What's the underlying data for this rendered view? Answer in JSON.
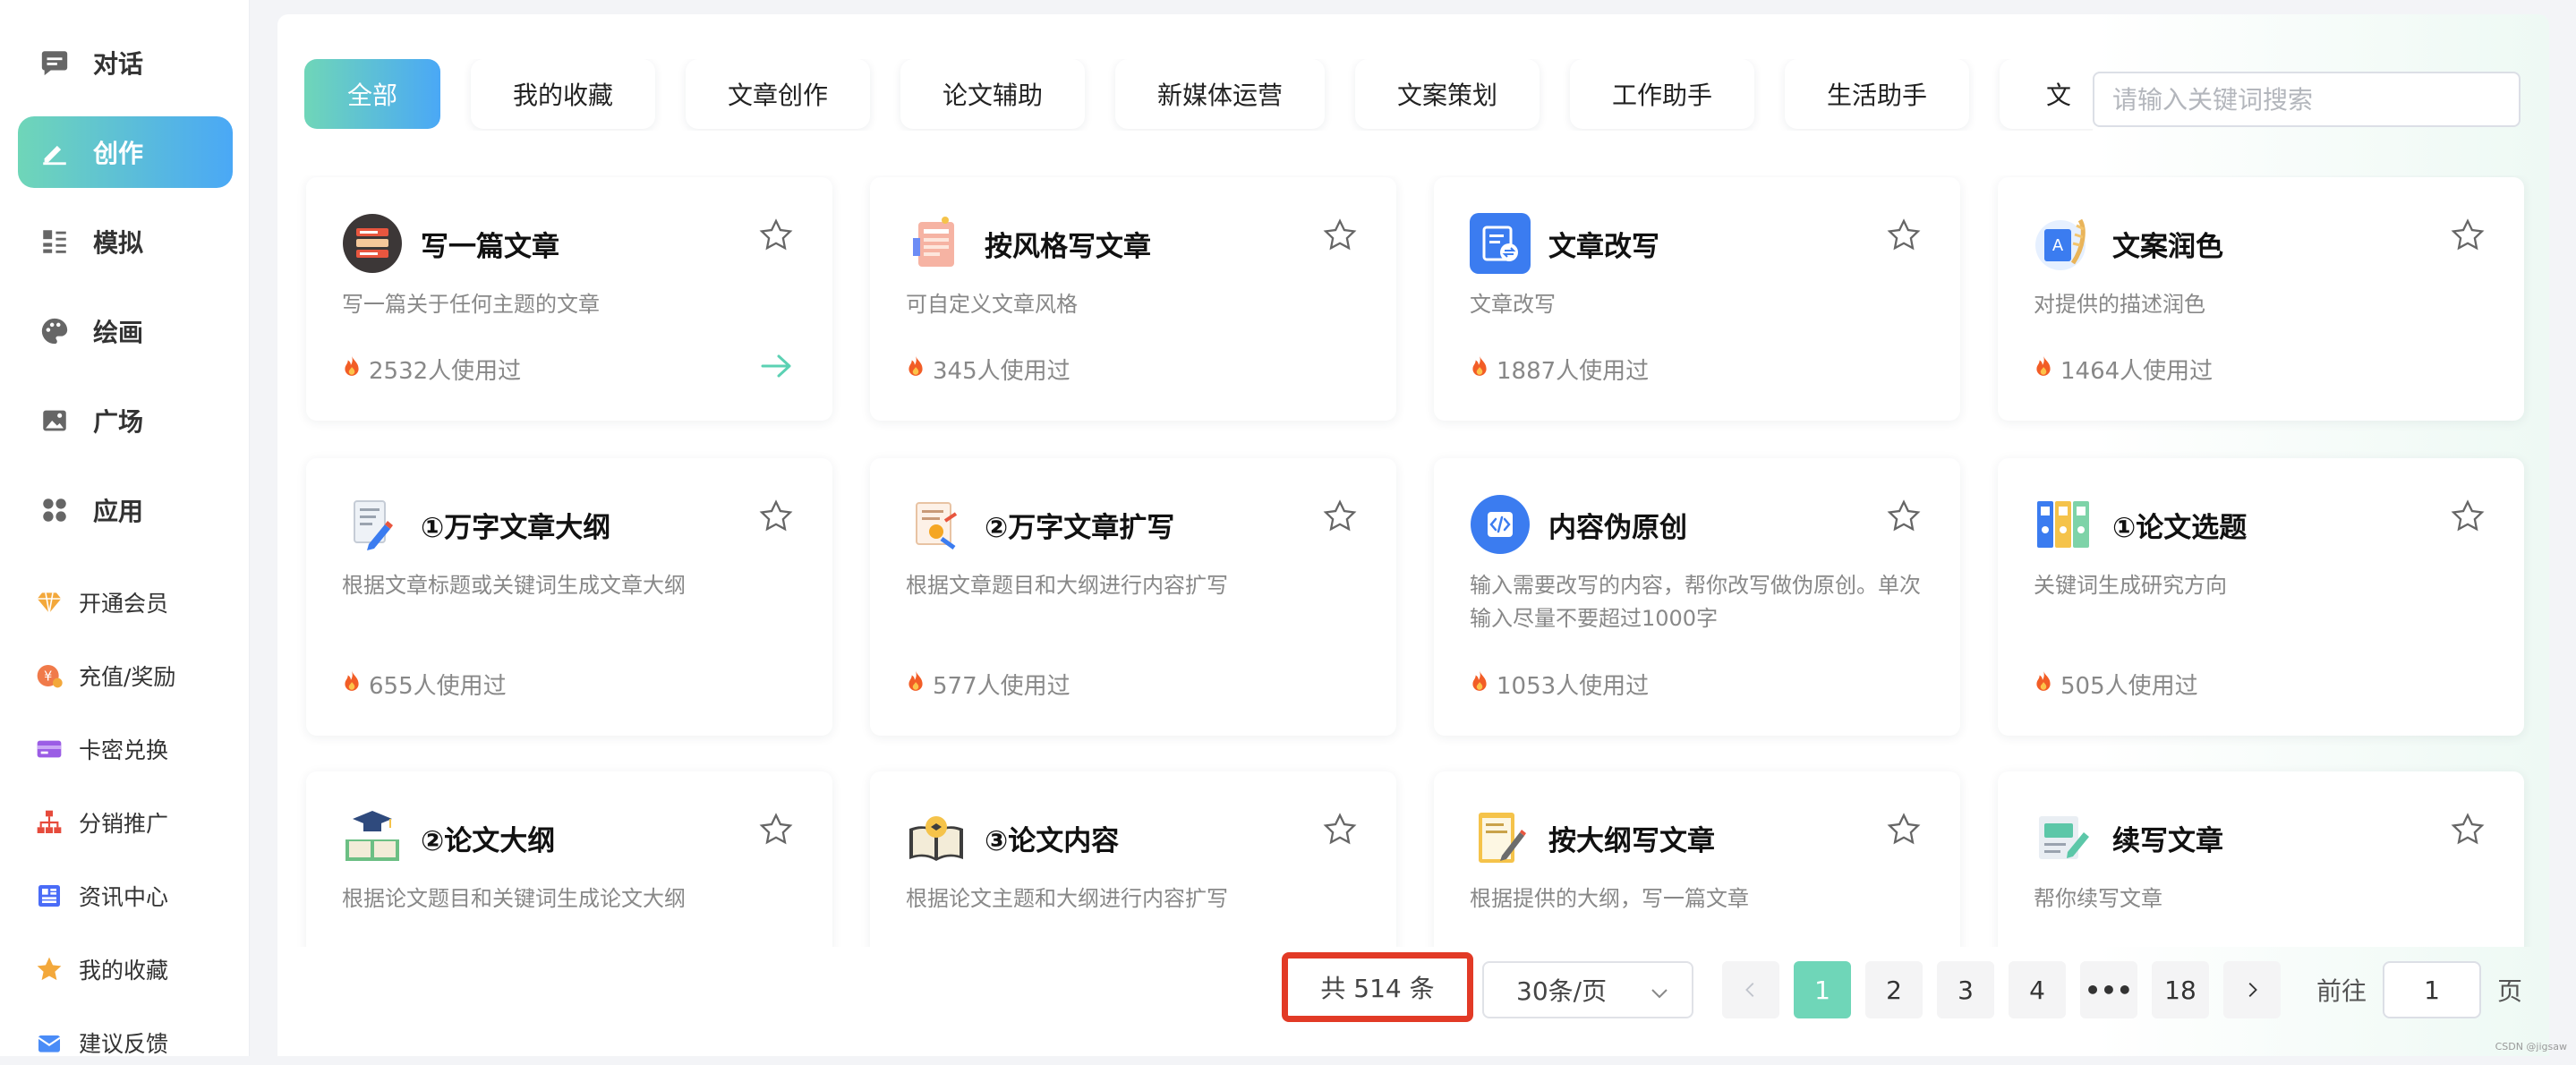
{
  "sidebar": {
    "nav": [
      {
        "label": "对话",
        "icon": "chat-icon"
      },
      {
        "label": "创作",
        "icon": "edit-icon",
        "active": true
      },
      {
        "label": "模拟",
        "icon": "list-icon"
      },
      {
        "label": "绘画",
        "icon": "palette-icon"
      },
      {
        "label": "广场",
        "icon": "image-icon"
      },
      {
        "label": "应用",
        "icon": "apps-icon"
      }
    ],
    "extra": [
      {
        "label": "开通会员",
        "icon": "diamond-icon"
      },
      {
        "label": "充值/奖励",
        "icon": "coin-icon"
      },
      {
        "label": "卡密兑换",
        "icon": "card-icon"
      },
      {
        "label": "分销推广",
        "icon": "network-icon"
      },
      {
        "label": "资讯中心",
        "icon": "news-icon"
      },
      {
        "label": "我的收藏",
        "icon": "star-icon"
      },
      {
        "label": "建议反馈",
        "icon": "feedback-icon"
      }
    ]
  },
  "tabs": [
    "全部",
    "我的收藏",
    "文章创作",
    "论文辅助",
    "新媒体运营",
    "文案策划",
    "工作助手",
    "生活助手",
    "文"
  ],
  "active_tab": "全部",
  "search": {
    "placeholder": "请输入关键词搜索",
    "value": ""
  },
  "cards": [
    {
      "title": "写一篇文章",
      "desc": "写一篇关于任何主题的文章",
      "usage": "2532人使用过",
      "icon": "article-stack-icon",
      "arrow": true
    },
    {
      "title": "按风格写文章",
      "desc": "可自定义文章风格",
      "usage": "345人使用过",
      "icon": "style-doc-icon"
    },
    {
      "title": "文章改写",
      "desc": "文章改写",
      "usage": "1887人使用过",
      "icon": "rewrite-icon"
    },
    {
      "title": "文案润色",
      "desc": "对提供的描述润色",
      "usage": "1464人使用过",
      "icon": "polish-icon"
    },
    {
      "title": "①万字文章大纲",
      "desc": "根据文章标题或关键词生成文章大纲",
      "usage": "655人使用过",
      "icon": "outline-pen-icon"
    },
    {
      "title": "②万字文章扩写",
      "desc": "根据文章题目和大纲进行内容扩写",
      "usage": "577人使用过",
      "icon": "expand-doc-icon"
    },
    {
      "title": "内容伪原创",
      "desc": "输入需要改写的内容，帮你改写做伪原创。单次输入尽量不要超过1000字",
      "usage": "1053人使用过",
      "icon": "code-icon"
    },
    {
      "title": "①论文选题",
      "desc": "关键词生成研究方向",
      "usage": "505人使用过",
      "icon": "binders-icon"
    },
    {
      "title": "②论文大纲",
      "desc": "根据论文题目和关键词生成论文大纲",
      "usage": "",
      "icon": "graduation-book-icon"
    },
    {
      "title": "③论文内容",
      "desc": "根据论文主题和大纲进行内容扩写",
      "usage": "",
      "icon": "open-book-icon"
    },
    {
      "title": "按大纲写文章",
      "desc": "根据提供的大纲，写一篇文章",
      "usage": "",
      "icon": "notepad-pen-icon"
    },
    {
      "title": "续写文章",
      "desc": "帮你续写文章",
      "usage": "",
      "icon": "continue-write-icon"
    }
  ],
  "pagination": {
    "total_text": "共 514 条",
    "page_size": "30条/页",
    "pages": [
      "1",
      "2",
      "3",
      "4",
      "•••",
      "18"
    ],
    "current": "1",
    "goto_label": "前往",
    "goto_value": "1",
    "page_suffix": "页"
  },
  "watermark": "CSDN @jigsaw",
  "colors": {
    "accent_start": "#6fd6b8",
    "accent_end": "#4aa8f6",
    "highlight_border": "#e23a26"
  }
}
